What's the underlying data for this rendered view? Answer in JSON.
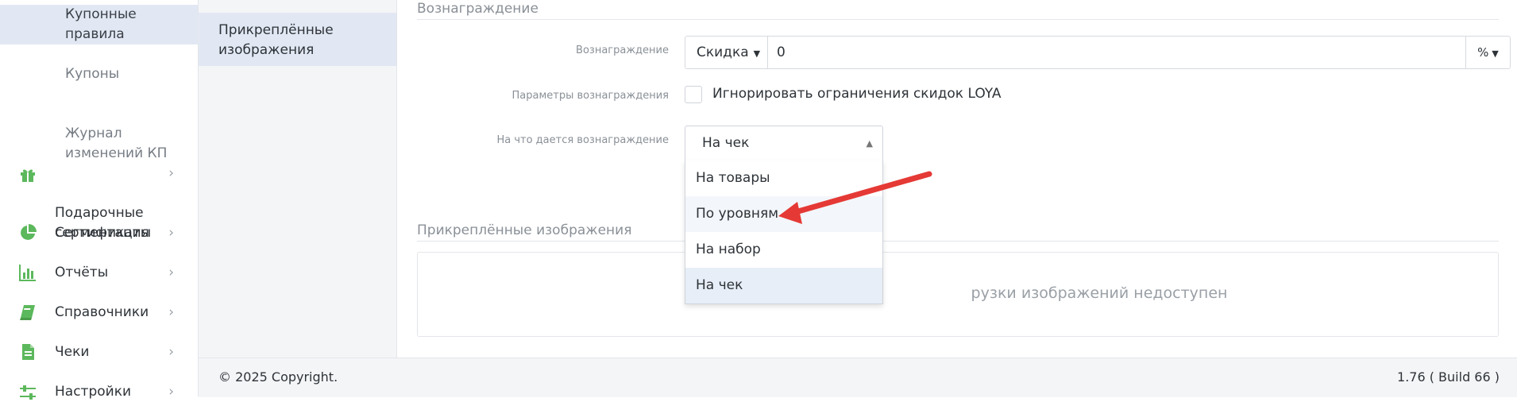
{
  "sidebar": {
    "sub_items": [
      {
        "label": "Купонные\nправила",
        "active": true
      },
      {
        "label": "Купоны"
      },
      {
        "label": "Журнал\nизменений КП"
      }
    ],
    "items": [
      {
        "label": "Подарочные\nсертификаты",
        "icon": "gift-icon"
      },
      {
        "label": "Сегментация",
        "icon": "pie-chart-icon"
      },
      {
        "label": "Отчёты",
        "icon": "bar-chart-icon"
      },
      {
        "label": "Справочники",
        "icon": "book-icon"
      },
      {
        "label": "Чеки",
        "icon": "receipt-icon"
      },
      {
        "label": "Настройки",
        "icon": "sliders-icon"
      }
    ],
    "chevron": "›"
  },
  "tabs": {
    "attached_images": "Прикреплённые\nизображения"
  },
  "reward_section": {
    "title": "Вознаграждение",
    "reward_label": "Вознаграждение",
    "reward_type": "Скидка",
    "reward_value": "0",
    "unit": "%",
    "params_label": "Параметры вознаграждения",
    "ignore_limits_label": "Игнорировать ограничения скидок LOYA",
    "ignore_limits_checked": false,
    "target_label": "На что дается вознаграждение",
    "target_value": "На чек",
    "target_options": [
      "На товары",
      "По уровням",
      "На набор",
      "На чек"
    ],
    "hovered_option": "По уровням"
  },
  "images_section": {
    "title": "Прикреплённые изображения",
    "message_partial": "рузки изображений недоступен"
  },
  "footer": {
    "copyright": "© 2025 Copyright.",
    "version": "1.76 ( Build 66 )"
  },
  "colors": {
    "accent_green": "#5cb85c",
    "arrow_red": "#e53935",
    "active_bg": "#e2e8f3"
  }
}
